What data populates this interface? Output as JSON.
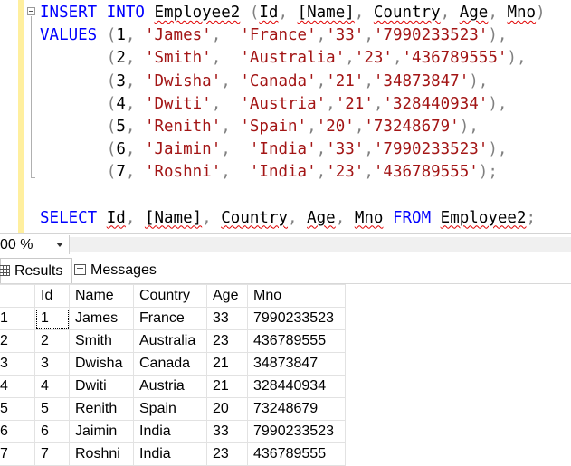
{
  "editor": {
    "lines": [
      [
        {
          "t": "INSERT",
          "c": "k"
        },
        {
          "t": " "
        },
        {
          "t": "INTO",
          "c": "k"
        },
        {
          "t": " "
        },
        {
          "t": "Employee2",
          "sq": true
        },
        {
          "t": " "
        },
        {
          "t": "(",
          "c": "p"
        },
        {
          "t": "Id",
          "sq": true
        },
        {
          "t": ",",
          "c": "p"
        },
        {
          "t": " "
        },
        {
          "t": "[Name]",
          "sq": true
        },
        {
          "t": ",",
          "c": "p"
        },
        {
          "t": " "
        },
        {
          "t": "Country",
          "sq": true
        },
        {
          "t": ",",
          "c": "p"
        },
        {
          "t": " "
        },
        {
          "t": "Age",
          "sq": true
        },
        {
          "t": ",",
          "c": "p"
        },
        {
          "t": " "
        },
        {
          "t": "Mno",
          "sq": true
        },
        {
          "t": ")",
          "c": "p"
        }
      ],
      [
        {
          "t": "VALUES",
          "c": "k"
        },
        {
          "t": " "
        },
        {
          "t": "(",
          "c": "p"
        },
        {
          "t": "1"
        },
        {
          "t": ",",
          "c": "p"
        },
        {
          "t": " "
        },
        {
          "t": "'James'",
          "c": "s"
        },
        {
          "t": ",",
          "c": "p"
        },
        {
          "t": "  "
        },
        {
          "t": "'France'",
          "c": "s"
        },
        {
          "t": ",",
          "c": "p"
        },
        {
          "t": "'33'",
          "c": "s"
        },
        {
          "t": ",",
          "c": "p"
        },
        {
          "t": "'7990233523'",
          "c": "s"
        },
        {
          "t": "),",
          "c": "p"
        }
      ],
      [
        {
          "t": "       "
        },
        {
          "t": "(",
          "c": "p"
        },
        {
          "t": "2"
        },
        {
          "t": ",",
          "c": "p"
        },
        {
          "t": " "
        },
        {
          "t": "'Smith'",
          "c": "s"
        },
        {
          "t": ",",
          "c": "p"
        },
        {
          "t": "  "
        },
        {
          "t": "'Australia'",
          "c": "s"
        },
        {
          "t": ",",
          "c": "p"
        },
        {
          "t": "'23'",
          "c": "s"
        },
        {
          "t": ",",
          "c": "p"
        },
        {
          "t": "'436789555'",
          "c": "s"
        },
        {
          "t": "),",
          "c": "p"
        }
      ],
      [
        {
          "t": "       "
        },
        {
          "t": "(",
          "c": "p"
        },
        {
          "t": "3"
        },
        {
          "t": ",",
          "c": "p"
        },
        {
          "t": " "
        },
        {
          "t": "'Dwisha'",
          "c": "s"
        },
        {
          "t": ",",
          "c": "p"
        },
        {
          "t": " "
        },
        {
          "t": "'Canada'",
          "c": "s"
        },
        {
          "t": ",",
          "c": "p"
        },
        {
          "t": "'21'",
          "c": "s"
        },
        {
          "t": ",",
          "c": "p"
        },
        {
          "t": "'34873847'",
          "c": "s"
        },
        {
          "t": "),",
          "c": "p"
        }
      ],
      [
        {
          "t": "       "
        },
        {
          "t": "(",
          "c": "p"
        },
        {
          "t": "4"
        },
        {
          "t": ",",
          "c": "p"
        },
        {
          "t": " "
        },
        {
          "t": "'Dwiti'",
          "c": "s"
        },
        {
          "t": ",",
          "c": "p"
        },
        {
          "t": "  "
        },
        {
          "t": "'Austria'",
          "c": "s"
        },
        {
          "t": ",",
          "c": "p"
        },
        {
          "t": "'21'",
          "c": "s"
        },
        {
          "t": ",",
          "c": "p"
        },
        {
          "t": "'328440934'",
          "c": "s"
        },
        {
          "t": "),",
          "c": "p"
        }
      ],
      [
        {
          "t": "       "
        },
        {
          "t": "(",
          "c": "p"
        },
        {
          "t": "5"
        },
        {
          "t": ",",
          "c": "p"
        },
        {
          "t": " "
        },
        {
          "t": "'Renith'",
          "c": "s"
        },
        {
          "t": ",",
          "c": "p"
        },
        {
          "t": " "
        },
        {
          "t": "'Spain'",
          "c": "s"
        },
        {
          "t": ",",
          "c": "p"
        },
        {
          "t": "'20'",
          "c": "s"
        },
        {
          "t": ",",
          "c": "p"
        },
        {
          "t": "'73248679'",
          "c": "s"
        },
        {
          "t": "),",
          "c": "p"
        }
      ],
      [
        {
          "t": "       "
        },
        {
          "t": "(",
          "c": "p"
        },
        {
          "t": "6"
        },
        {
          "t": ",",
          "c": "p"
        },
        {
          "t": " "
        },
        {
          "t": "'Jaimin'",
          "c": "s"
        },
        {
          "t": ",",
          "c": "p"
        },
        {
          "t": "  "
        },
        {
          "t": "'India'",
          "c": "s"
        },
        {
          "t": ",",
          "c": "p"
        },
        {
          "t": "'33'",
          "c": "s"
        },
        {
          "t": ",",
          "c": "p"
        },
        {
          "t": "'7990233523'",
          "c": "s"
        },
        {
          "t": "),",
          "c": "p"
        }
      ],
      [
        {
          "t": "       "
        },
        {
          "t": "(",
          "c": "p"
        },
        {
          "t": "7"
        },
        {
          "t": ",",
          "c": "p"
        },
        {
          "t": " "
        },
        {
          "t": "'Roshni'",
          "c": "s"
        },
        {
          "t": ",",
          "c": "p"
        },
        {
          "t": "  "
        },
        {
          "t": "'India'",
          "c": "s"
        },
        {
          "t": ",",
          "c": "p"
        },
        {
          "t": "'23'",
          "c": "s"
        },
        {
          "t": ",",
          "c": "p"
        },
        {
          "t": "'436789555'",
          "c": "s"
        },
        {
          "t": ");",
          "c": "p"
        }
      ],
      [
        {
          "t": ""
        }
      ],
      [
        {
          "t": "SELECT",
          "c": "k"
        },
        {
          "t": " "
        },
        {
          "t": "Id",
          "sq": true
        },
        {
          "t": ",",
          "c": "p"
        },
        {
          "t": " "
        },
        {
          "t": "[Name]",
          "sq": true
        },
        {
          "t": ",",
          "c": "p"
        },
        {
          "t": " "
        },
        {
          "t": "Country",
          "sq": true
        },
        {
          "t": ",",
          "c": "p"
        },
        {
          "t": " "
        },
        {
          "t": "Age",
          "sq": true
        },
        {
          "t": ",",
          "c": "p"
        },
        {
          "t": " "
        },
        {
          "t": "Mno",
          "sq": true
        },
        {
          "t": " "
        },
        {
          "t": "FROM",
          "c": "k"
        },
        {
          "t": " "
        },
        {
          "t": "Employee2",
          "sq": true
        },
        {
          "t": ";",
          "c": "p"
        }
      ]
    ]
  },
  "zoom": {
    "value": "00 %"
  },
  "tabs": {
    "results_label": "Results",
    "messages_label": "Messages"
  },
  "grid": {
    "columns": [
      "Id",
      "Name",
      "Country",
      "Age",
      "Mno"
    ],
    "rows": [
      {
        "row_number": "1",
        "cells": [
          "1",
          "James",
          "France",
          "33",
          "7990233523"
        ]
      },
      {
        "row_number": "2",
        "cells": [
          "2",
          "Smith",
          "Australia",
          "23",
          "436789555"
        ]
      },
      {
        "row_number": "3",
        "cells": [
          "3",
          "Dwisha",
          "Canada",
          "21",
          "34873847"
        ]
      },
      {
        "row_number": "4",
        "cells": [
          "4",
          "Dwiti",
          "Austria",
          "21",
          "328440934"
        ]
      },
      {
        "row_number": "5",
        "cells": [
          "5",
          "Renith",
          "Spain",
          "20",
          "73248679"
        ]
      },
      {
        "row_number": "6",
        "cells": [
          "6",
          "Jaimin",
          "India",
          "33",
          "7990233523"
        ]
      },
      {
        "row_number": "7",
        "cells": [
          "7",
          "Roshni",
          "India",
          "23",
          "436789555"
        ]
      }
    ]
  },
  "colors": {
    "keyword": "#0000ff",
    "string": "#a31515",
    "punctuation": "#808080",
    "margin_bar": "#ffef9e"
  }
}
